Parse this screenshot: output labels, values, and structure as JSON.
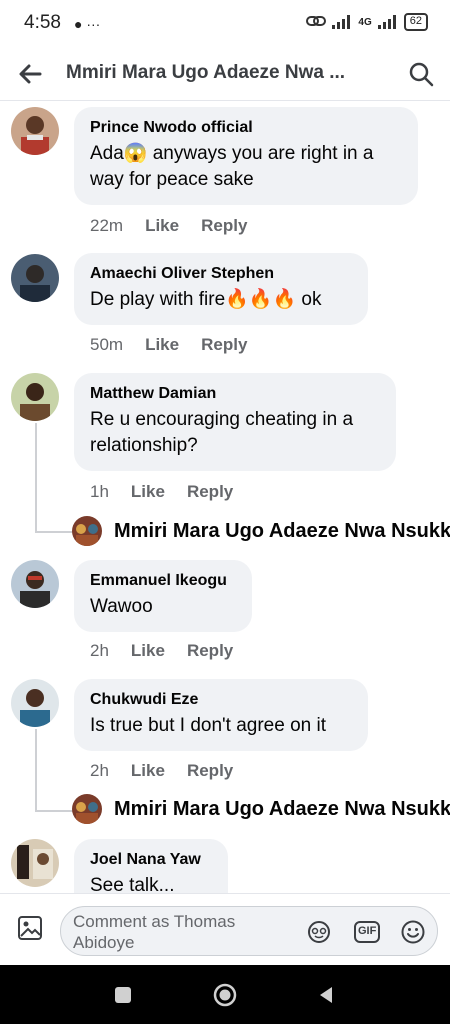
{
  "status_bar": {
    "time": "4:58",
    "notif_icons": "● ···",
    "network": "4G",
    "battery": "62"
  },
  "header": {
    "title": "Mmiri Mara Ugo Adaeze Nwa ..."
  },
  "comments": [
    {
      "author": "Prince Nwodo official",
      "text": "Ada😱 anyways you are right in a way for peace sake",
      "time": "22m",
      "like": "Like",
      "reply": "Reply"
    },
    {
      "author": "Amaechi Oliver Stephen",
      "text": "De play with fire🔥🔥🔥 ok",
      "time": "50m",
      "like": "Like",
      "reply": "Reply"
    },
    {
      "author": "Matthew Damian",
      "text": "Re u encouraging cheating in a relationship?",
      "time": "1h",
      "like": "Like",
      "reply": "Reply",
      "reply_author": "Mmiri Mara Ugo Adaeze Nwa Nsukka"
    },
    {
      "author": "Emmanuel Ikeogu",
      "text": "Wawoo",
      "time": "2h",
      "like": "Like",
      "reply": "Reply"
    },
    {
      "author": "Chukwudi Eze",
      "text": "Is true but I don't agree on it",
      "time": "2h",
      "like": "Like",
      "reply": "Reply",
      "reply_author": "Mmiri Mara Ugo Adaeze Nwa Nsukka"
    },
    {
      "author": "Joel Nana Yaw",
      "text": "See talk..."
    }
  ],
  "composer": {
    "placeholder": "Comment as Thomas Abidoye",
    "gif_label": "GIF"
  },
  "colors": {
    "bubble": "#f0f2f5",
    "meta": "#65676b",
    "text": "#050505"
  }
}
